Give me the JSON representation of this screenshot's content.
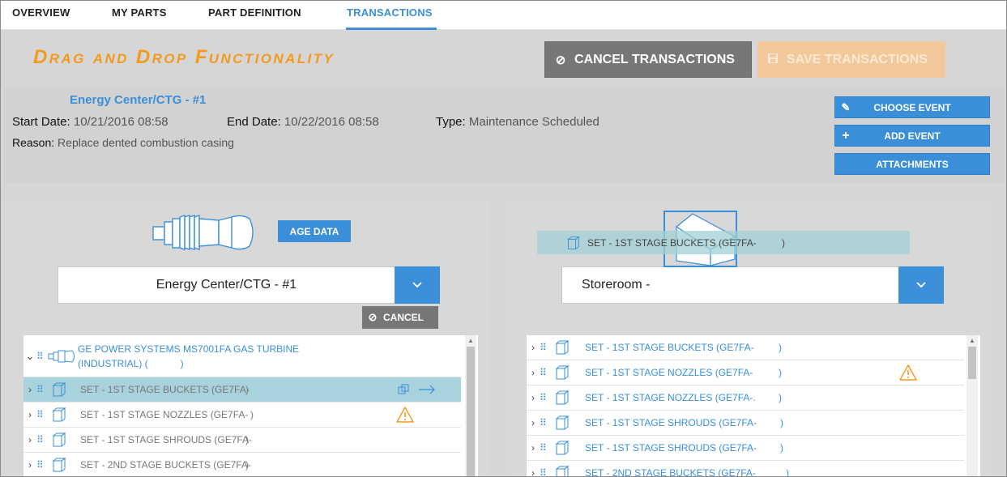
{
  "tabs": [
    {
      "label": "OVERVIEW"
    },
    {
      "label": "MY PARTS"
    },
    {
      "label": "PART DEFINITION"
    },
    {
      "label": "TRANSACTIONS",
      "active": true
    }
  ],
  "header": {
    "title": "Drag and Drop Functionality",
    "cancel_label": "CANCEL TRANSACTIONS",
    "save_label": "SAVE TRANSACTIONS"
  },
  "event": {
    "name": "Energy Center/CTG - #1",
    "start_label": "Start Date:",
    "start_value": "10/21/2016 08:58",
    "end_label": "End Date:",
    "end_value": "10/22/2016 08:58",
    "type_label": "Type:",
    "type_value": "Maintenance Scheduled",
    "reason_label": "Reason:",
    "reason_value": "Replace dented combustion casing",
    "buttons": {
      "choose": "CHOOSE EVENT",
      "add": "ADD EVENT",
      "attachments": "ATTACHMENTS"
    }
  },
  "left_panel": {
    "age_data_label": "AGE DATA",
    "selected": "Energy Center/CTG - #1",
    "cancel_label": "CANCEL",
    "parent": {
      "line1": "GE POWER SYSTEMS MS7001FA GAS TURBINE",
      "line2": "(INDUSTRIAL) (",
      "line2_end": ")"
    },
    "items": [
      {
        "label": "SET - 1ST STAGE BUCKETS (GE7FA-",
        "end": ")",
        "selected": true
      },
      {
        "label": "SET - 1ST STAGE NOZZLES (GE7FA-",
        "end": ")",
        "warning": true
      },
      {
        "label": "SET - 1ST STAGE SHROUDS (GE7FA-",
        "end": ")"
      },
      {
        "label": "SET - 2ND STAGE BUCKETS (GE7FA-",
        "end": ")"
      }
    ]
  },
  "right_panel": {
    "selected": "Storeroom -",
    "drag_ghost": {
      "label": "SET - 1ST STAGE BUCKETS (GE7FA-",
      "end": ")"
    },
    "items": [
      {
        "label": "SET - 1ST STAGE BUCKETS (GE7FA-",
        "end": ")"
      },
      {
        "label": "SET - 1ST STAGE NOZZLES (GE7FA-",
        "end": ")",
        "warning": true
      },
      {
        "label": "SET - 1ST STAGE NOZZLES (GE7FA-.",
        "end": ")"
      },
      {
        "label": "SET - 1ST STAGE SHROUDS (GE7FA-",
        "end": ")"
      },
      {
        "label": "SET - 1ST STAGE SHROUDS (GE7FA-",
        "end": ")"
      },
      {
        "label": "SET - 2ND STAGE BUCKETS (GE7FA-",
        "end": ")"
      }
    ]
  },
  "colors": {
    "accent": "#3a8fd8",
    "title": "#f39a1e",
    "selected_row": "#a8d2dc",
    "warning": "#f39a1e",
    "cancel": "#777777"
  }
}
